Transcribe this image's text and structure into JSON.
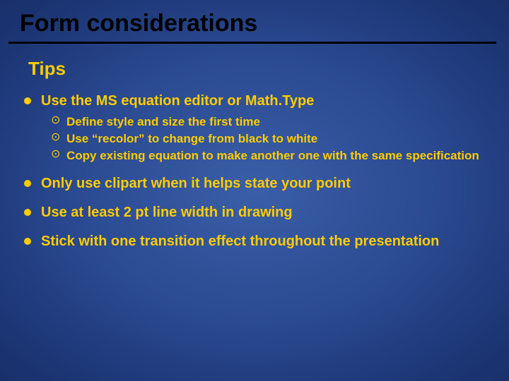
{
  "title": "Form considerations",
  "subtitle": "Tips",
  "bullets": [
    {
      "text": "Use the MS equation editor or Math.Type",
      "sub": [
        "Define style and size  the first time",
        "Use “recolor” to change from black to white",
        "Copy existing equation to make another one with the same specification"
      ]
    },
    {
      "text": "Only use clipart when it helps state your point"
    },
    {
      "text": "Use at least 2 pt line width in drawing"
    },
    {
      "text": "Stick with one transition effect throughout the presentation"
    }
  ]
}
